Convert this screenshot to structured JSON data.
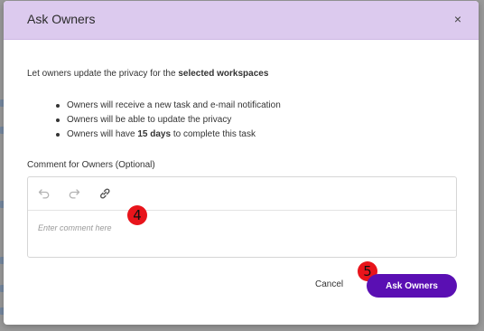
{
  "modal": {
    "title": "Ask Owners",
    "close_icon": "×",
    "intro_prefix": "Let owners update the privacy for the ",
    "intro_bold": "selected workspaces",
    "bullets": {
      "b1": "Owners will receive a new task and e-mail notification",
      "b2": "Owners will be able to update the privacy",
      "b3_prefix": "Owners will have ",
      "b3_bold": "15 days",
      "b3_suffix": " to complete this task"
    },
    "comment_label": "Comment for Owners (Optional)",
    "editor": {
      "placeholder": "Enter comment here",
      "toolbar": [
        "undo-icon",
        "redo-icon",
        "link-icon"
      ]
    },
    "cancel_label": "Cancel",
    "ask_label": "Ask Owners"
  },
  "markers": {
    "m4": "4",
    "m5": "5"
  },
  "colors": {
    "header_bg": "#dccaee",
    "primary_button": "#5a0fb3",
    "marker": "#e8141b"
  }
}
